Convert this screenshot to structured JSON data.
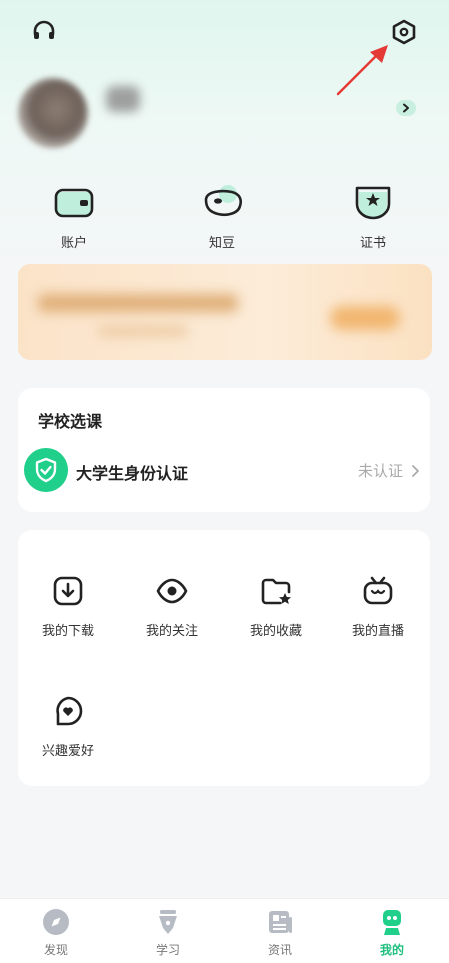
{
  "quick_actions": [
    {
      "label": "账户",
      "icon": "wallet-icon"
    },
    {
      "label": "知豆",
      "icon": "bean-icon"
    },
    {
      "label": "证书",
      "icon": "certificate-icon"
    }
  ],
  "school": {
    "title": "学校选课",
    "verify_label": "大学生身份认证",
    "verify_status": "未认证"
  },
  "mine_items": [
    {
      "label": "我的下载",
      "icon": "download-icon"
    },
    {
      "label": "我的关注",
      "icon": "eye-icon"
    },
    {
      "label": "我的收藏",
      "icon": "favorites-icon"
    },
    {
      "label": "我的直播",
      "icon": "tv-icon"
    },
    {
      "label": "兴趣爱好",
      "icon": "heart-bubble-icon"
    }
  ],
  "tabs": [
    {
      "label": "发现",
      "icon": "compass-icon",
      "active": false
    },
    {
      "label": "学习",
      "icon": "pen-icon",
      "active": false
    },
    {
      "label": "资讯",
      "icon": "news-icon",
      "active": false
    },
    {
      "label": "我的",
      "icon": "mine-icon",
      "active": true
    }
  ],
  "colors": {
    "accent": "#1fcf8a",
    "accent_light": "#bfeedd",
    "annotation_arrow": "#e53935"
  }
}
